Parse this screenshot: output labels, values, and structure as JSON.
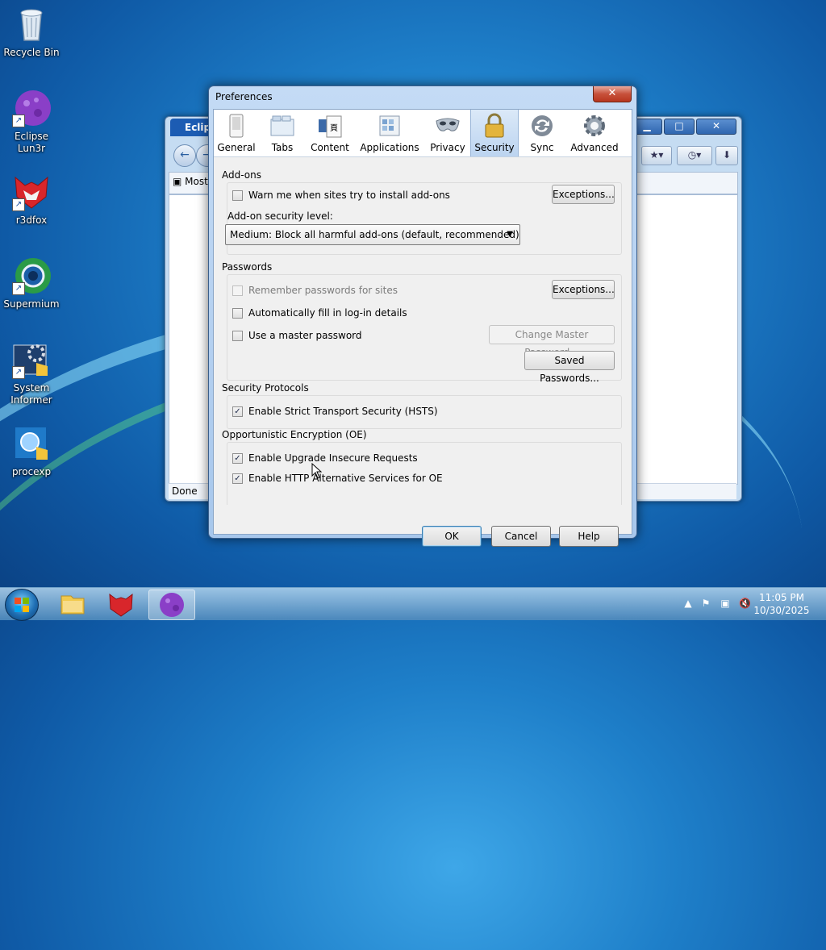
{
  "desktop": {
    "icons": [
      {
        "label": "Recycle Bin"
      },
      {
        "label": "Eclipse Lun3r"
      },
      {
        "label": "r3dfox"
      },
      {
        "label": "Supermium"
      },
      {
        "label": "System Informer"
      },
      {
        "label": "procexp"
      }
    ]
  },
  "browser": {
    "tab_title": "Eclips",
    "bookmark_text": "Most",
    "status_text": "Done"
  },
  "dialog": {
    "title": "Preferences",
    "close_glyph": "✕",
    "tabs": [
      {
        "label": "General",
        "icon": "general-icon"
      },
      {
        "label": "Tabs",
        "icon": "tabs-icon"
      },
      {
        "label": "Content",
        "icon": "content-icon"
      },
      {
        "label": "Applications",
        "icon": "applications-icon"
      },
      {
        "label": "Privacy",
        "icon": "privacy-mask-icon"
      },
      {
        "label": "Security",
        "icon": "security-lock-icon",
        "active": true
      },
      {
        "label": "Sync",
        "icon": "sync-icon"
      },
      {
        "label": "Advanced",
        "icon": "advanced-gear-icon"
      }
    ],
    "addons": {
      "heading": "Add-ons",
      "warn_label": "Warn me when sites try to install add-ons",
      "warn_checked": false,
      "exceptions_label": "Exceptions...",
      "security_level_label": "Add-on security level:",
      "security_level_value": "Medium: Block all harmful add-ons (default, recommended)"
    },
    "passwords": {
      "heading": "Passwords",
      "remember_label": "Remember passwords for sites",
      "remember_checked": false,
      "exceptions_label": "Exceptions...",
      "autofill_label": "Automatically fill in log-in details",
      "autofill_checked": false,
      "master_label": "Use a master password",
      "master_checked": false,
      "change_master_label": "Change Master Password...",
      "saved_passwords_label": "Saved Passwords..."
    },
    "security_protocols": {
      "heading": "Security Protocols",
      "hsts_label": "Enable Strict Transport Security (HSTS)",
      "hsts_checked": true
    },
    "oe": {
      "heading": "Opportunistic Encryption (OE)",
      "upgrade_label": "Enable Upgrade Insecure Requests",
      "upgrade_checked": true,
      "http_alt_label": "Enable HTTP Alternative Services for OE",
      "http_alt_checked": true
    },
    "footer": {
      "ok_label": "OK",
      "cancel_label": "Cancel",
      "help_label": "Help"
    }
  },
  "taskbar": {
    "time": "11:05 PM",
    "date": "10/30/2025"
  },
  "colors": {
    "accent": "#1e7fc9",
    "dialog_frame": "#a7c7ec"
  }
}
